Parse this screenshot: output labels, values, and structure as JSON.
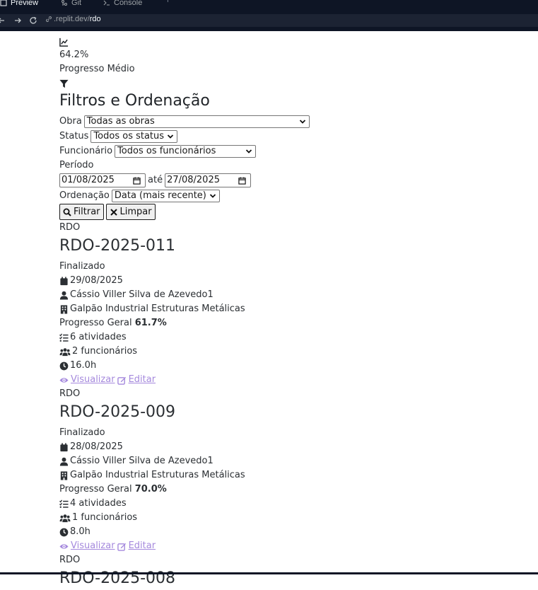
{
  "browser": {
    "tabs": [
      {
        "label": "Preview",
        "icon": "preview-icon",
        "active": true
      },
      {
        "label": "Git",
        "icon": "git-icon",
        "active": false
      },
      {
        "label": "Console",
        "icon": "console-icon",
        "active": false
      }
    ],
    "url_host": ".replit.dev/",
    "url_path": "rdo"
  },
  "stats": {
    "icon": "chart-line-icon",
    "value": "64.2%",
    "label": "Progresso Médio"
  },
  "filters": {
    "icon": "filter-icon",
    "title": "Filtros e Ordenação",
    "obra_label": "Obra",
    "obra_value": "Todas as obras",
    "status_label": "Status",
    "status_value": "Todos os status",
    "funcionario_label": "Funcionário",
    "funcionario_value": "Todos os funcionários",
    "periodo_label": "Período",
    "date_from": "01/08/2025",
    "ate_label": "até",
    "date_to": "27/08/2025",
    "ordenacao_label": "Ordenação",
    "ordenacao_value": "Data (mais recente)",
    "filter_button": "Filtrar",
    "clear_button": "Limpar"
  },
  "rdos": [
    {
      "kind": "RDO",
      "number": "RDO-2025-011",
      "status": "Finalizado",
      "date": "29/08/2025",
      "employee": "Cássio Viller Silva de Azevedo1",
      "site": "Galpão Industrial Estruturas Metálicas",
      "progress_label": "Progresso Geral",
      "progress_value": "61.7%",
      "activities": "6 atividades",
      "workers": "2 funcionários",
      "hours": "16.0h",
      "view_label": "Visualizar",
      "edit_label": "Editar"
    },
    {
      "kind": "RDO",
      "number": "RDO-2025-009",
      "status": "Finalizado",
      "date": "28/08/2025",
      "employee": "Cássio Viller Silva de Azevedo1",
      "site": "Galpão Industrial Estruturas Metálicas",
      "progress_label": "Progresso Geral",
      "progress_value": "70.0%",
      "activities": "4 atividades",
      "workers": "1 funcionários",
      "hours": "8.0h",
      "view_label": "Visualizar",
      "edit_label": "Editar"
    },
    {
      "kind": "RDO",
      "number": "RDO-2025-008"
    }
  ],
  "colors": {
    "chrome_dark": "#0e1525",
    "url_bar": "#1c2333",
    "link": "#a589dd",
    "text": "#2b2f33"
  }
}
